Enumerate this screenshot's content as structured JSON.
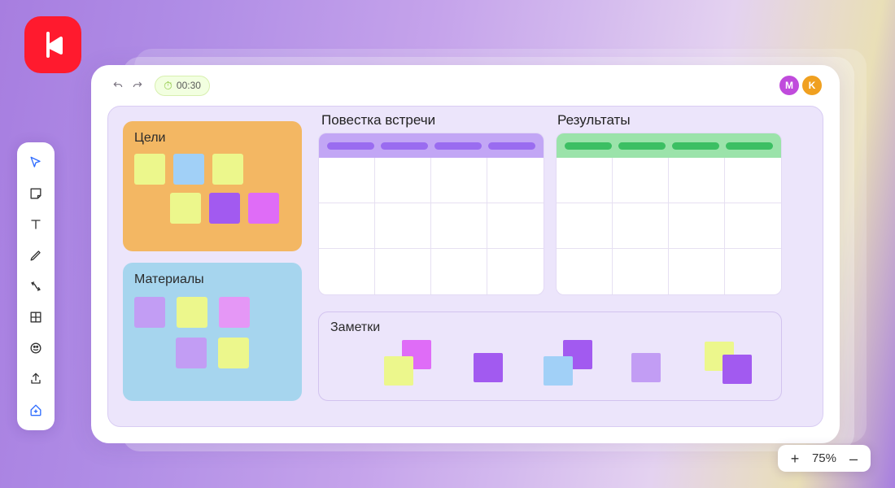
{
  "timer": {
    "value": "00:30"
  },
  "avatars": {
    "m": "M",
    "k": "K"
  },
  "panels": {
    "goals_title": "Цели",
    "materials_title": "Материалы",
    "agenda_title": "Повестка встречи",
    "results_title": "Результаты",
    "notes_title": "Заметки"
  },
  "zoom": {
    "plus": "+",
    "level": "75%",
    "minus": "–"
  },
  "goals_stickies": {
    "r1": [
      "c-ylw",
      "c-blu",
      "c-ylw"
    ],
    "r2": [
      "c-ylw",
      "c-pur",
      "c-mag"
    ]
  },
  "materials_stickies": {
    "r1": [
      "c-lil",
      "c-ylw",
      "c-pnk"
    ],
    "r2": [
      "c-lil",
      "c-ylw"
    ]
  },
  "notes_stickies": [
    {
      "cls": "c-mag",
      "l": 88,
      "t": 2
    },
    {
      "cls": "c-ylw",
      "l": 66,
      "t": 22
    },
    {
      "cls": "c-pur",
      "l": 176,
      "t": 18
    },
    {
      "cls": "c-pur",
      "l": 286,
      "t": 2
    },
    {
      "cls": "c-blu",
      "l": 262,
      "t": 22
    },
    {
      "cls": "c-lil",
      "l": 370,
      "t": 18
    },
    {
      "cls": "c-ylw",
      "l": 460,
      "t": 4
    },
    {
      "cls": "c-pur",
      "l": 482,
      "t": 20
    }
  ],
  "agenda_cols": 4,
  "results_cols": 4,
  "grid_cells": 12
}
